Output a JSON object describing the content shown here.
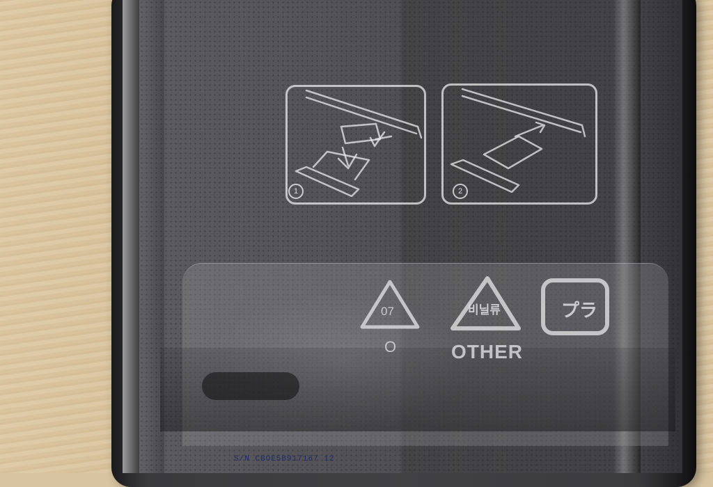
{
  "recycling": {
    "code_number": "07",
    "code_letter": "O",
    "vinyl_text": "비닐류",
    "other_text": "OTHER",
    "plastic_text": "プラ"
  },
  "instructions": {
    "step_1": "1",
    "step_2": "2"
  },
  "serial_number": "S/N CBOE5B917167   12"
}
